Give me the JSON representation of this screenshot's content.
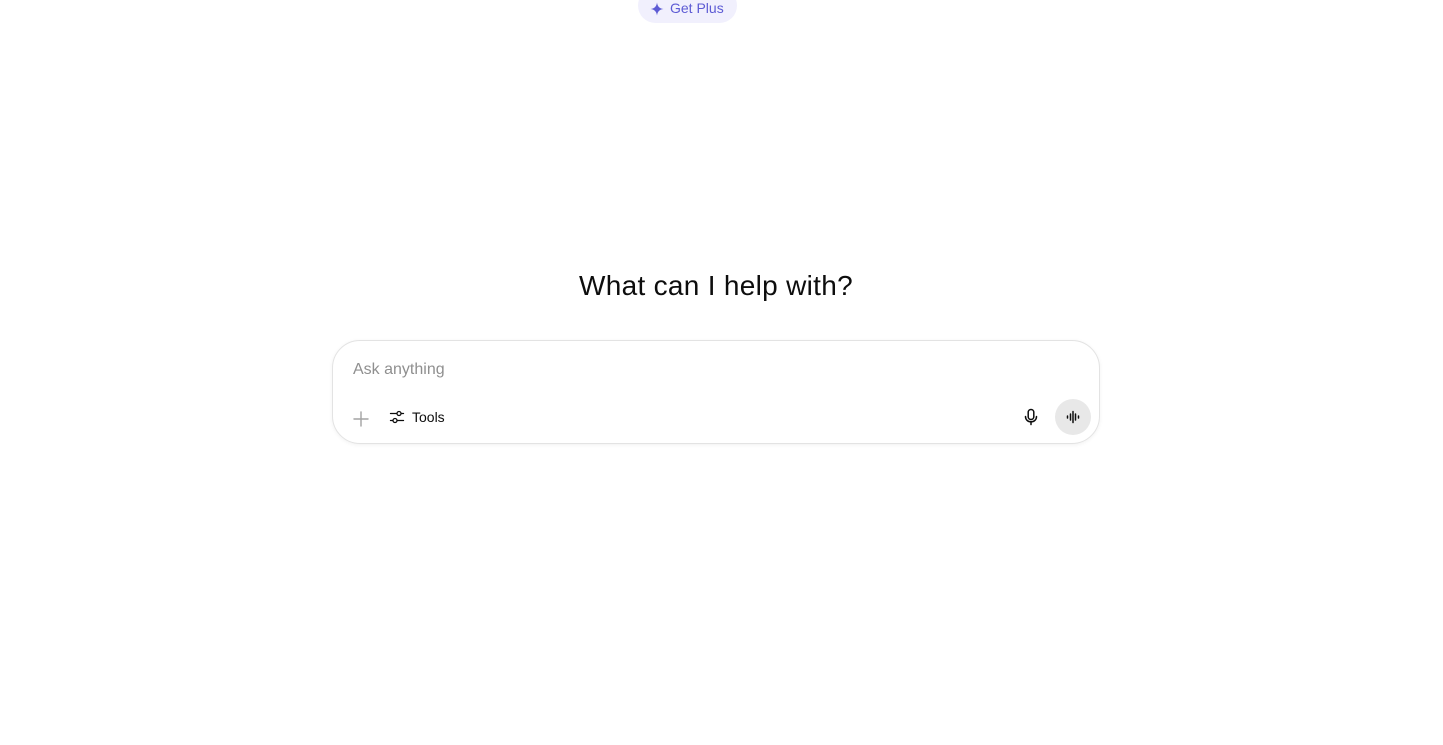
{
  "header": {
    "get_plus_label": "Get Plus",
    "get_plus_icon": "sparkle-icon",
    "accent_color": "#5d5bd4"
  },
  "main": {
    "headline": "What can I help with?"
  },
  "composer": {
    "value": "",
    "placeholder": "Ask anything",
    "add_icon": "plus-icon",
    "tools_label": "Tools",
    "tools_icon": "sliders-icon",
    "mic_icon": "microphone-icon",
    "voice_icon": "voice-waveform-icon"
  }
}
